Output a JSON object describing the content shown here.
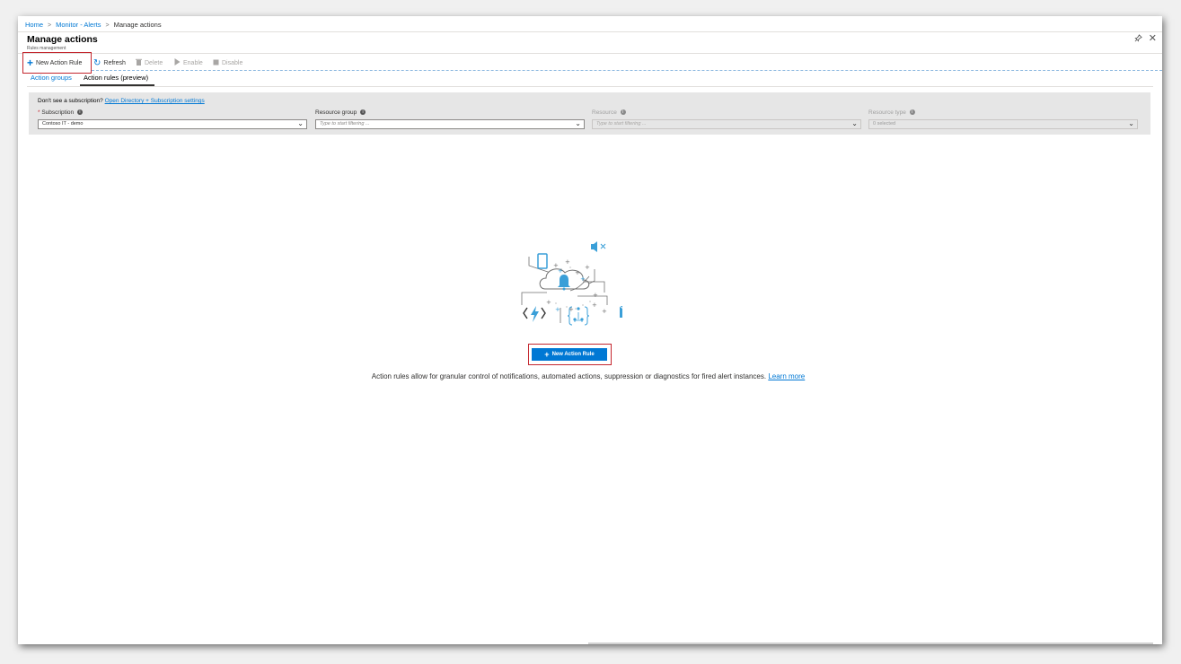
{
  "breadcrumb": {
    "items": [
      "Home",
      "Monitor - Alerts",
      "Manage actions"
    ]
  },
  "blade": {
    "title": "Manage actions",
    "subtitle": "Rules management"
  },
  "toolbar": {
    "new_action_rule": "New Action Rule",
    "refresh": "Refresh",
    "delete": "Delete",
    "enable": "Enable",
    "disable": "Disable"
  },
  "tabs": [
    "Action groups",
    "Action rules (preview)"
  ],
  "filters": {
    "no_subscription_text": "Don't see a subscription?",
    "no_subscription_link": "Open Directory + Subscription settings",
    "subscription": {
      "label": "Subscription",
      "value": "Contoso IT - demo"
    },
    "resource_group": {
      "label": "Resource group",
      "placeholder": "Type to start filtering ..."
    },
    "resource": {
      "label": "Resource",
      "placeholder": "Type to start filtering ..."
    },
    "resource_type": {
      "label": "Resource type",
      "value": "0 selected"
    }
  },
  "empty_state": {
    "button_label": "New Action Rule",
    "description": "Action rules allow for granular control of notifications, automated actions, suppression or diagnostics for fired alert instances.",
    "learn_more": "Learn more"
  },
  "colors": {
    "accent": "#0078d4",
    "highlight_box": "#c4262e",
    "illustration": "#3a9fd8"
  },
  "icons": [
    "plus-icon",
    "refresh-icon",
    "trash-icon",
    "play-icon",
    "stop-icon",
    "pin-icon",
    "close-icon",
    "info-icon",
    "chevron-down-icon",
    "bell-cloud-illustration"
  ]
}
